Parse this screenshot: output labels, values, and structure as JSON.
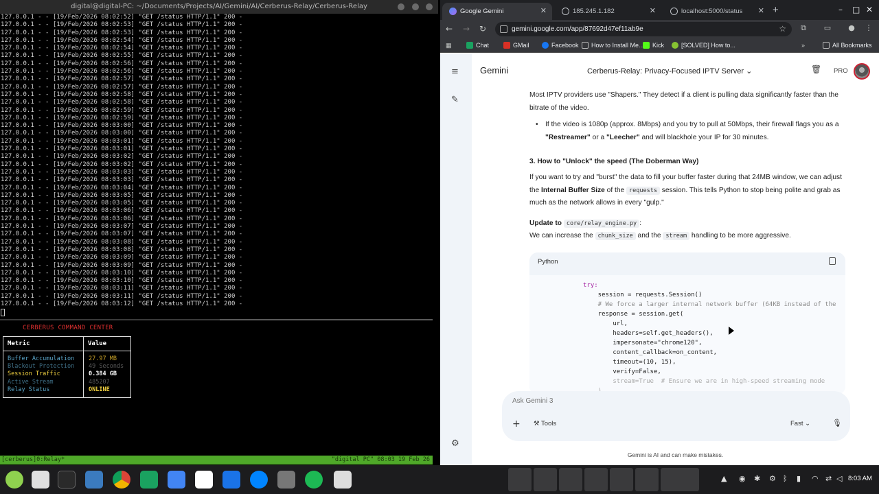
{
  "terminal": {
    "title": "digital@digital-PC: ~/Documents/Projects/AI/Gemini/AI/Cerberus-Relay/Cerberus-Relay",
    "log_lines": [
      "127.0.0.1 - - [19/Feb/2026 08:02:52] \"GET /status HTTP/1.1\" 200 -",
      "127.0.0.1 - - [19/Feb/2026 08:02:53] \"GET /status HTTP/1.1\" 200 -",
      "127.0.0.1 - - [19/Feb/2026 08:02:53] \"GET /status HTTP/1.1\" 200 -",
      "127.0.0.1 - - [19/Feb/2026 08:02:54] \"GET /status HTTP/1.1\" 200 -",
      "127.0.0.1 - - [19/Feb/2026 08:02:54] \"GET /status HTTP/1.1\" 200 -",
      "127.0.0.1 - - [19/Feb/2026 08:02:55] \"GET /status HTTP/1.1\" 200 -",
      "127.0.0.1 - - [19/Feb/2026 08:02:56] \"GET /status HTTP/1.1\" 200 -",
      "127.0.0.1 - - [19/Feb/2026 08:02:56] \"GET /status HTTP/1.1\" 200 -",
      "127.0.0.1 - - [19/Feb/2026 08:02:57] \"GET /status HTTP/1.1\" 200 -",
      "127.0.0.1 - - [19/Feb/2026 08:02:57] \"GET /status HTTP/1.1\" 200 -",
      "127.0.0.1 - - [19/Feb/2026 08:02:58] \"GET /status HTTP/1.1\" 200 -",
      "127.0.0.1 - - [19/Feb/2026 08:02:58] \"GET /status HTTP/1.1\" 200 -",
      "127.0.0.1 - - [19/Feb/2026 08:02:59] \"GET /status HTTP/1.1\" 200 -",
      "127.0.0.1 - - [19/Feb/2026 08:02:59] \"GET /status HTTP/1.1\" 200 -",
      "127.0.0.1 - - [19/Feb/2026 08:03:00] \"GET /status HTTP/1.1\" 200 -",
      "127.0.0.1 - - [19/Feb/2026 08:03:00] \"GET /status HTTP/1.1\" 200 -",
      "127.0.0.1 - - [19/Feb/2026 08:03:01] \"GET /status HTTP/1.1\" 200 -",
      "127.0.0.1 - - [19/Feb/2026 08:03:01] \"GET /status HTTP/1.1\" 200 -",
      "127.0.0.1 - - [19/Feb/2026 08:03:02] \"GET /status HTTP/1.1\" 200 -",
      "127.0.0.1 - - [19/Feb/2026 08:03:02] \"GET /status HTTP/1.1\" 200 -",
      "127.0.0.1 - - [19/Feb/2026 08:03:03] \"GET /status HTTP/1.1\" 200 -",
      "127.0.0.1 - - [19/Feb/2026 08:03:03] \"GET /status HTTP/1.1\" 200 -",
      "127.0.0.1 - - [19/Feb/2026 08:03:04] \"GET /status HTTP/1.1\" 200 -",
      "127.0.0.1 - - [19/Feb/2026 08:03:05] \"GET /status HTTP/1.1\" 200 -",
      "127.0.0.1 - - [19/Feb/2026 08:03:05] \"GET /status HTTP/1.1\" 200 -",
      "127.0.0.1 - - [19/Feb/2026 08:03:06] \"GET /status HTTP/1.1\" 200 -",
      "127.0.0.1 - - [19/Feb/2026 08:03:06] \"GET /status HTTP/1.1\" 200 -",
      "127.0.0.1 - - [19/Feb/2026 08:03:07] \"GET /status HTTP/1.1\" 200 -",
      "127.0.0.1 - - [19/Feb/2026 08:03:07] \"GET /status HTTP/1.1\" 200 -",
      "127.0.0.1 - - [19/Feb/2026 08:03:08] \"GET /status HTTP/1.1\" 200 -",
      "127.0.0.1 - - [19/Feb/2026 08:03:08] \"GET /status HTTP/1.1\" 200 -",
      "127.0.0.1 - - [19/Feb/2026 08:03:09] \"GET /status HTTP/1.1\" 200 -",
      "127.0.0.1 - - [19/Feb/2026 08:03:09] \"GET /status HTTP/1.1\" 200 -",
      "127.0.0.1 - - [19/Feb/2026 08:03:10] \"GET /status HTTP/1.1\" 200 -",
      "127.0.0.1 - - [19/Feb/2026 08:03:10] \"GET /status HTTP/1.1\" 200 -",
      "127.0.0.1 - - [19/Feb/2026 08:03:11] \"GET /status HTTP/1.1\" 200 -",
      "127.0.0.1 - - [19/Feb/2026 08:03:11] \"GET /status HTTP/1.1\" 200 -",
      "127.0.0.1 - - [19/Feb/2026 08:03:12] \"GET /status HTTP/1.1\" 200 -"
    ],
    "command_center": {
      "title": "CERBERUS COMMAND CENTER",
      "col_metric": "Metric",
      "col_value": "Value",
      "rows": [
        {
          "metric": "Buffer Accumulation",
          "value": "27.97 MB",
          "metric_color": "#5aa5c8",
          "value_color": "#c9a227"
        },
        {
          "metric": "Blackout Protection",
          "value": "49 Seconds",
          "metric_color": "#3f6f86",
          "value_color": "#5a5a5a"
        },
        {
          "metric": "Session Traffic",
          "value": "0.384 GB",
          "metric_color": "#f0d040",
          "value_color": "#ffffff"
        },
        {
          "metric": "Active Stream",
          "value": "485207",
          "metric_color": "#3f6f86",
          "value_color": "#5a5a5a"
        },
        {
          "metric": "Relay Status",
          "value": "ONLINE",
          "metric_color": "#5aa5c8",
          "value_color": "#f0d040"
        }
      ]
    },
    "tmux_left": "[cerberus]0:Relay*",
    "tmux_right": "\"digital PC\" 08:03 19 Feb 26"
  },
  "browser": {
    "tabs": [
      {
        "label": "Google Gemini",
        "active": true
      },
      {
        "label": "185.245.1.182",
        "active": false
      },
      {
        "label": "localhost:5000/status",
        "active": false
      }
    ],
    "url": "gemini.google.com/app/87692d47ef11ab9e",
    "bookmarks": [
      "Chat",
      "GMail",
      "Facebook",
      "How to Install Me...",
      "Kick",
      "[SOLVED] How to...",
      "All Bookmarks"
    ]
  },
  "gemini": {
    "brand": "Gemini",
    "chat_title": "Cerberus-Relay: Privacy-Focused IPTV Server",
    "pro_label": "PRO",
    "ask_placeholder": "Ask Gemini 3",
    "tools_label": "Tools",
    "mode_label": "Fast",
    "disclaimer": "Gemini is AI and can make mistakes.",
    "para1": "Most IPTV providers use \"Shapers.\" They detect if a client is pulling data significantly faster than the bitrate of the video.",
    "bullet_pre": "If the video is 1080p (approx. 8Mbps) and you try to pull at 50Mbps, their firewall flags you as a ",
    "bullet_b1": "\"Restreamer\"",
    "bullet_mid": " or a ",
    "bullet_b2": "\"Leecher\"",
    "bullet_post": " and will blackhole your IP for 30 minutes.",
    "heading3": "3. How to \"Unlock\" the speed (The Doberman Way)",
    "para2_pre": "If you want to try and \"burst\" the data to fill your buffer faster during that 24MB window, we can adjust the ",
    "para2_b": "Internal Buffer Size",
    "para2_mid": " of the ",
    "para2_code": "requests",
    "para2_post": " session. This tells Python to stop being polite and grab as much as the network allows in every \"gulp.\"",
    "update_b": "Update to",
    "update_code": "core/relay_engine.py",
    "update_colon": ":",
    "para3_pre": "We can increase the ",
    "para3_code1": "chunk_size",
    "para3_mid": " and the ",
    "para3_code2": "stream",
    "para3_post": " handling to be more aggressive.",
    "code_lang": "Python",
    "code_lines": [
      "try:",
      "    session = requests.Session()",
      "    # We force a larger internal network buffer (64KB instead of the",
      "    response = session.get(",
      "        url,",
      "        headers=self.get_headers(),",
      "        impersonate=\"chrome120\",",
      "        content_callback=on_content,",
      "        timeout=(10, 15),",
      "        verify=False,",
      "        stream=True  # Ensure we are in high-speed streaming mode",
      "    )"
    ]
  },
  "taskbar": {
    "clock": "8:03 AM"
  }
}
